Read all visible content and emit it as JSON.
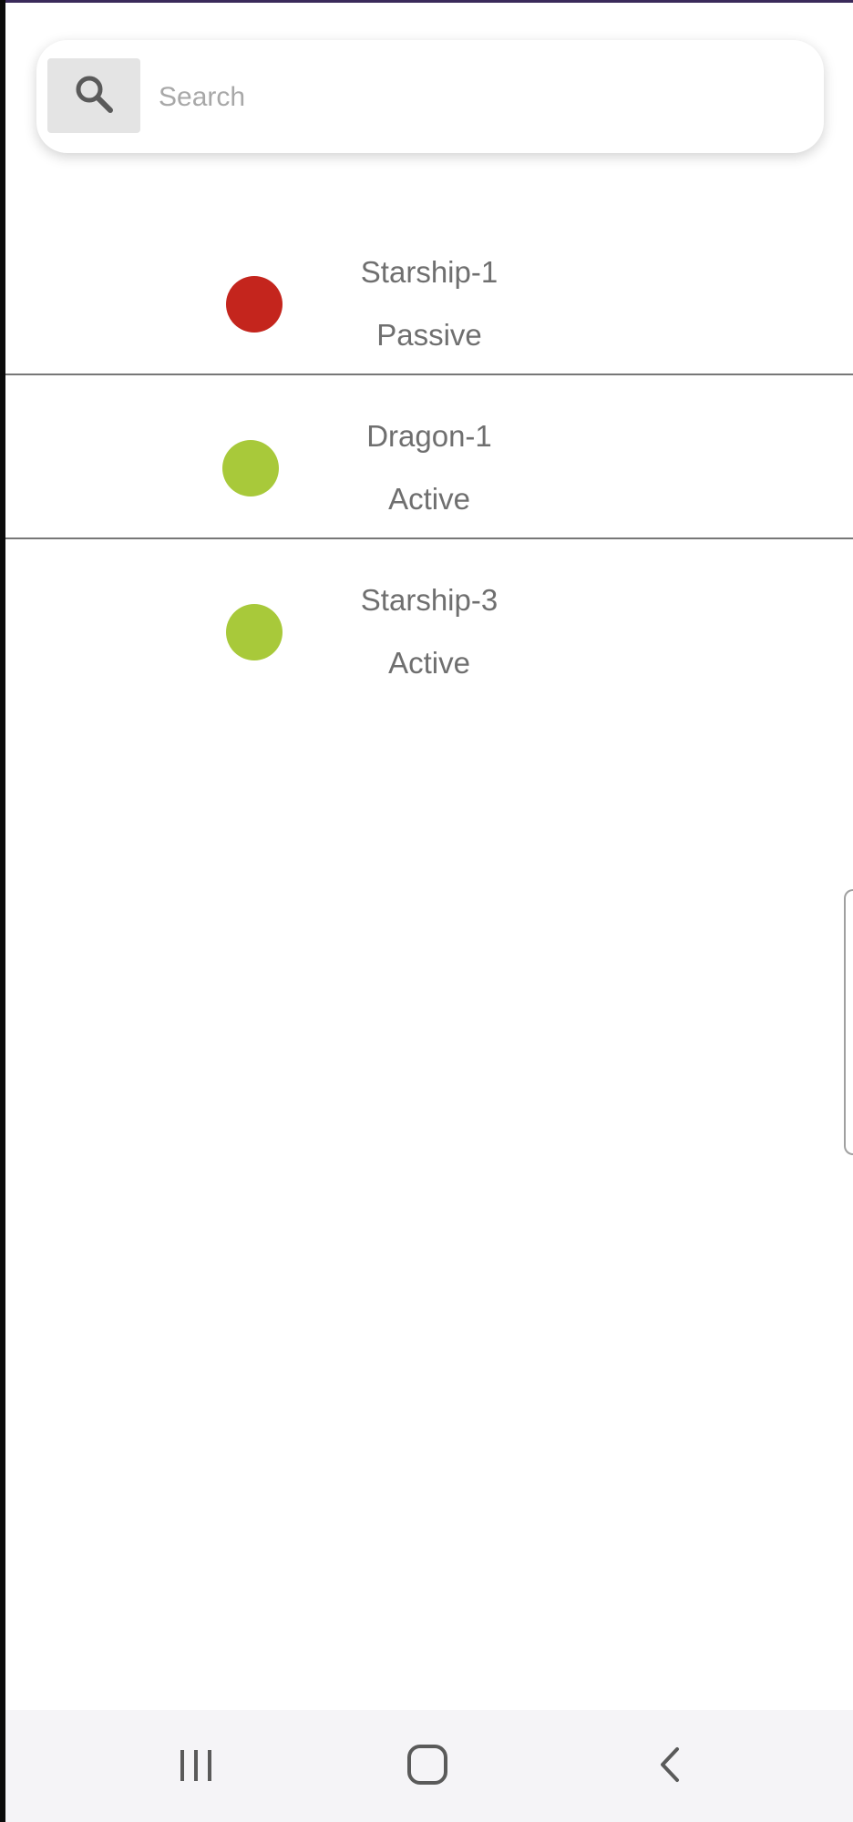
{
  "search": {
    "placeholder": "Search",
    "value": "",
    "icon": "search-icon"
  },
  "devices": [
    {
      "name": "Starship-1",
      "status": "Passive",
      "status_color": "#c4251d"
    },
    {
      "name": "Dragon-1",
      "status": "Active",
      "status_color": "#a8c93a"
    },
    {
      "name": "Starship-3",
      "status": "Active",
      "status_color": "#a8c93a"
    }
  ],
  "nav": {
    "recents_icon": "recents-icon",
    "home_icon": "home-icon",
    "back_icon": "back-icon"
  }
}
